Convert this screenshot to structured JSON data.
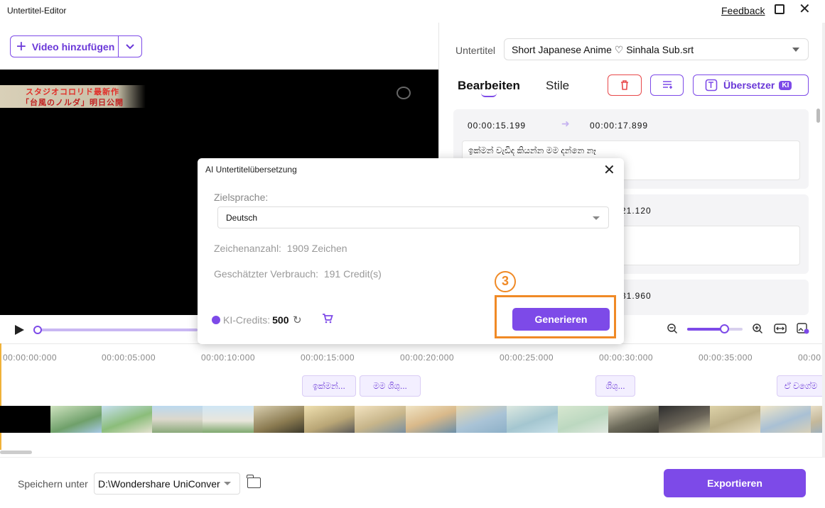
{
  "window": {
    "title": "Untertitel-Editor",
    "feedback_label": "Feedback"
  },
  "toolbar": {
    "add_video_label": "Video hinzufügen"
  },
  "subtitle_panel": {
    "subtitle_label": "Untertitel",
    "subtitle_file": "Short Japanese Anime ♡ Sinhala Sub.srt",
    "tabs": [
      {
        "label": "Bearbeiten",
        "active": true
      },
      {
        "label": "Stile",
        "active": false
      }
    ],
    "translator_label": "Übersetzer",
    "translator_badge": "KI",
    "cards": [
      {
        "start": "00:00:15.199",
        "end": "00:00:17.899",
        "text": "ඉක්මන් වැඩිද කියන්න මම දන්නෙ නෑ"
      },
      {
        "end_partial": "21.120"
      },
      {
        "end_partial": "31.960"
      }
    ]
  },
  "video": {
    "overlay_line1": "スタジオコロリド最新作",
    "overlay_line2": "「台風のノルダ」明日公開"
  },
  "timeline": {
    "ticks": [
      "00:00:00:000",
      "00:00:05:000",
      "00:00:10:000",
      "00:00:15:000",
      "00:00:20:000",
      "00:00:25:000",
      "00:00:30:000",
      "00:00:35:000",
      "00:00"
    ],
    "chips": [
      "ඉක්මන්...",
      "මම ශිශු...",
      "ශිශු...",
      "ඒ වගේම"
    ]
  },
  "bottom": {
    "save_label": "Speichern unter",
    "save_path": "D:\\Wondershare UniConver",
    "export_label": "Exportieren"
  },
  "dialog": {
    "title": "AI Untertitelübersetzung",
    "target_language_label": "Zielsprache:",
    "target_language_value": "Deutsch",
    "char_count_label": "Zeichenanzahl:",
    "char_count_value": "1909 Zeichen",
    "usage_label": "Geschätzter Verbrauch:",
    "usage_value": "191 Credit(s)",
    "credits_label": "KI-Credits:",
    "credits_value": "500",
    "generate_label": "Generieren",
    "step_badge": "3"
  },
  "colors": {
    "accent": "#7d4ae8",
    "highlight": "#f08a26",
    "delete": "#e8484a"
  }
}
